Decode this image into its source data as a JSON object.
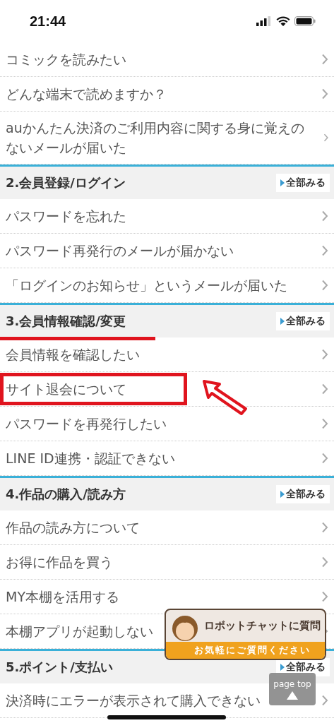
{
  "status_bar": {
    "time": "21:44"
  },
  "top_items": [
    {
      "label": "コミックを読みたい",
      "highlighted": false
    },
    {
      "label": "どんな端末で読めますか？",
      "highlighted": false
    },
    {
      "label": "auかんたん決済のご利用内容に関する身に覚えのないメールが届いた",
      "highlighted": false
    }
  ],
  "sections": [
    {
      "title": "2.会員登録/ログイン",
      "link": "全部みる",
      "underlined": false,
      "items": [
        {
          "label": "パスワードを忘れた",
          "highlighted": false
        },
        {
          "label": "パスワード再発行のメールが届かない",
          "highlighted": false
        },
        {
          "label": "「ログインのお知らせ」というメールが届いた",
          "highlighted": false
        }
      ]
    },
    {
      "title": "3.会員情報確認/変更",
      "link": "全部みる",
      "underlined": true,
      "items": [
        {
          "label": "会員情報を確認したい",
          "highlighted": false
        },
        {
          "label": "サイト退会について",
          "highlighted": true
        },
        {
          "label": "パスワードを再発行したい",
          "highlighted": false
        },
        {
          "label": "LINE ID連携・認証できない",
          "highlighted": false
        }
      ]
    },
    {
      "title": "4.作品の購入/読み方",
      "link": "全部みる",
      "underlined": false,
      "items": [
        {
          "label": "作品の読み方について",
          "highlighted": false
        },
        {
          "label": "お得に作品を買う",
          "highlighted": false
        },
        {
          "label": "MY本棚を活用する",
          "highlighted": false
        },
        {
          "label": "本棚アプリが起動しない",
          "highlighted": false
        }
      ]
    },
    {
      "title": "5.ポイント/支払い",
      "link": "全部みる",
      "underlined": false,
      "items": [
        {
          "label": "決済時にエラーが表示されて購入できない",
          "highlighted": false
        }
      ]
    }
  ],
  "chat_widget": {
    "title": "ロボットチャットに質問",
    "subtitle": "お気軽にご質問ください"
  },
  "page_top": {
    "label": "page top"
  }
}
